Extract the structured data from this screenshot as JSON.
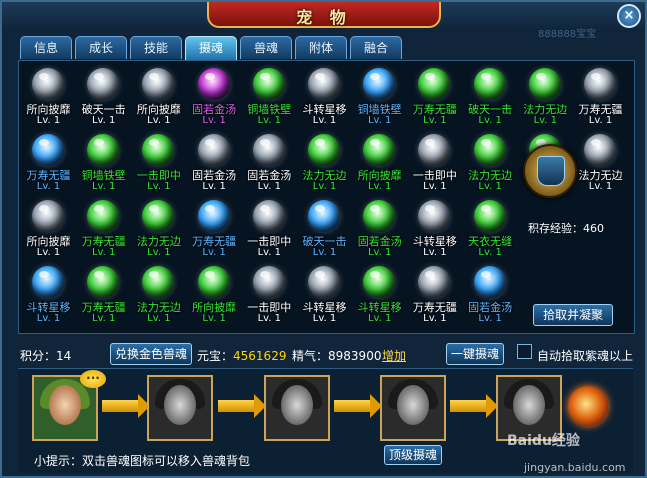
{
  "window": {
    "title": "宠 物",
    "close_symbol": "×",
    "top_watermark": "888888宝宝"
  },
  "tabs": [
    {
      "label": "信息",
      "active": false
    },
    {
      "label": "成长",
      "active": false
    },
    {
      "label": "技能",
      "active": false
    },
    {
      "label": "摄魂",
      "active": true
    },
    {
      "label": "兽魂",
      "active": false
    },
    {
      "label": "附体",
      "active": false
    },
    {
      "label": "融合",
      "active": false
    }
  ],
  "souls": [
    {
      "name": "所向披靡",
      "level": "Lv. 1",
      "orb": "white",
      "text": "white"
    },
    {
      "name": "破天一击",
      "level": "Lv. 1",
      "orb": "white",
      "text": "white"
    },
    {
      "name": "所向披靡",
      "level": "Lv. 1",
      "orb": "white",
      "text": "white"
    },
    {
      "name": "固若金汤",
      "level": "Lv. 1",
      "orb": "purple",
      "text": "purple"
    },
    {
      "name": "铜墙铁壁",
      "level": "Lv. 1",
      "orb": "green",
      "text": "green"
    },
    {
      "name": "斗转星移",
      "level": "Lv. 1",
      "orb": "white",
      "text": "white"
    },
    {
      "name": "铜墙铁壁",
      "level": "Lv. 1",
      "orb": "blue",
      "text": "blue"
    },
    {
      "name": "万寿无疆",
      "level": "Lv. 1",
      "orb": "green",
      "text": "green"
    },
    {
      "name": "破天一击",
      "level": "Lv. 1",
      "orb": "green",
      "text": "green"
    },
    {
      "name": "法力无边",
      "level": "Lv. 1",
      "orb": "green",
      "text": "green"
    },
    {
      "name": "万寿无疆",
      "level": "Lv. 1",
      "orb": "white",
      "text": "white"
    },
    {
      "name": "万寿无疆",
      "level": "Lv. 1",
      "orb": "blue",
      "text": "blue"
    },
    {
      "name": "铜墙铁壁",
      "level": "Lv. 1",
      "orb": "green",
      "text": "green"
    },
    {
      "name": "一击即中",
      "level": "Lv. 1",
      "orb": "green",
      "text": "green"
    },
    {
      "name": "固若金汤",
      "level": "Lv. 1",
      "orb": "white",
      "text": "white"
    },
    {
      "name": "固若金汤",
      "level": "Lv. 1",
      "orb": "white",
      "text": "white"
    },
    {
      "name": "法力无边",
      "level": "Lv. 1",
      "orb": "green",
      "text": "green"
    },
    {
      "name": "所向披靡",
      "level": "Lv. 1",
      "orb": "green",
      "text": "green"
    },
    {
      "name": "一击即中",
      "level": "Lv. 1",
      "orb": "white",
      "text": "white"
    },
    {
      "name": "法力无边",
      "level": "Lv. 1",
      "orb": "green",
      "text": "green"
    },
    {
      "name": "铜墙铁壁",
      "level": "Lv. 1",
      "orb": "green",
      "text": "green"
    },
    {
      "name": "法力无边",
      "level": "Lv. 1",
      "orb": "white",
      "text": "white"
    },
    {
      "name": "所向披靡",
      "level": "Lv. 1",
      "orb": "white",
      "text": "white"
    },
    {
      "name": "万寿无疆",
      "level": "Lv. 1",
      "orb": "green",
      "text": "green"
    },
    {
      "name": "法力无边",
      "level": "Lv. 1",
      "orb": "green",
      "text": "green"
    },
    {
      "name": "万寿无疆",
      "level": "Lv. 1",
      "orb": "blue",
      "text": "blue"
    },
    {
      "name": "一击即中",
      "level": "Lv. 1",
      "orb": "white",
      "text": "white"
    },
    {
      "name": "破天一击",
      "level": "Lv. 1",
      "orb": "blue",
      "text": "blue"
    },
    {
      "name": "固若金汤",
      "level": "Lv. 1",
      "orb": "green",
      "text": "green"
    },
    {
      "name": "斗转星移",
      "level": "Lv. 1",
      "orb": "white",
      "text": "white"
    },
    {
      "name": "天衣无缝",
      "level": "Lv. 1",
      "orb": "green",
      "text": "green"
    },
    {
      "name": "斗转星移",
      "level": "Lv. 1",
      "orb": "blue",
      "text": "blue"
    },
    {
      "name": "万寿无疆",
      "level": "Lv. 1",
      "orb": "green",
      "text": "green"
    },
    {
      "name": "法力无边",
      "level": "Lv. 1",
      "orb": "green",
      "text": "green"
    },
    {
      "name": "所向披靡",
      "level": "Lv. 1",
      "orb": "green",
      "text": "green"
    },
    {
      "name": "一击即中",
      "level": "Lv. 1",
      "orb": "white",
      "text": "white"
    },
    {
      "name": "斗转星移",
      "level": "Lv. 1",
      "orb": "white",
      "text": "white"
    },
    {
      "name": "斗转星移",
      "level": "Lv. 1",
      "orb": "green",
      "text": "green"
    },
    {
      "name": "万寿无疆",
      "level": "Lv. 1",
      "orb": "white",
      "text": "white"
    },
    {
      "name": "固若金汤",
      "level": "Lv. 1",
      "orb": "blue",
      "text": "blue"
    }
  ],
  "colors": {
    "white": "#ffffff",
    "blue": "#5fb4ff",
    "green": "#37e334",
    "purple": "#e05cf0",
    "gold": "#ffd700"
  },
  "side": {
    "cauldron_icon": "cauldron-icon",
    "exp_label": "积存经验：",
    "exp_value": "460",
    "extract_button": "拾取并凝聚"
  },
  "stats": {
    "points_label": "积分：",
    "points_value": "14",
    "exchange_button": "兑换金色兽魂",
    "yuanbao_label": "元宝：",
    "yuanbao_value": "4561629",
    "essence_label": "精气：",
    "essence_value": "8983900",
    "add_link": "增加",
    "one_key_button": "一键摄魂",
    "auto_pick_label": "自动拾取紫魂以上",
    "auto_pick_checked": false
  },
  "bottom": {
    "speech_symbol": "···",
    "top_button": "顶级摄魂",
    "hint": "小提示：双击兽魂图标可以移入兽魂背包",
    "watermark1": "Baidu经验",
    "watermark2": "jingyan.baidu.com"
  }
}
